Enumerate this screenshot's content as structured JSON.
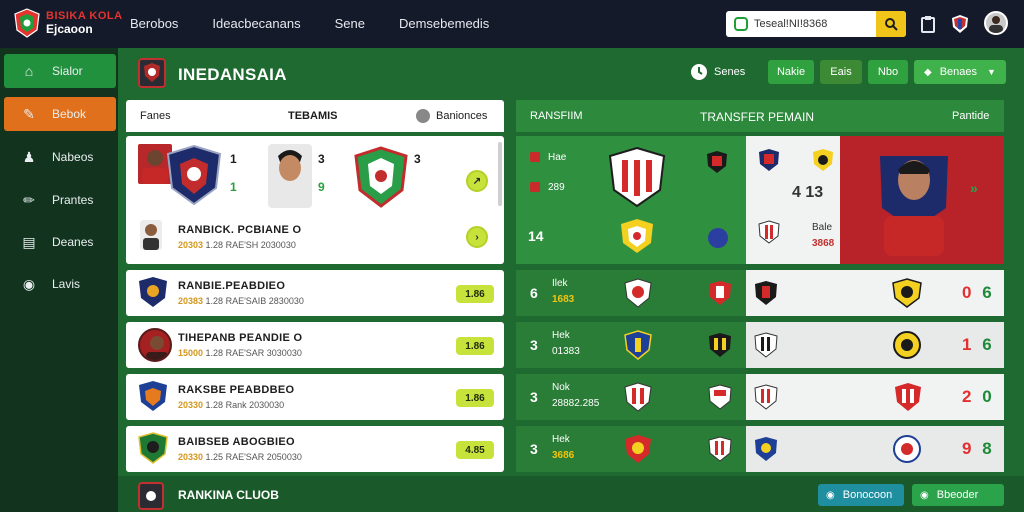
{
  "app": {
    "logo_line1": "BISIKA KOLA",
    "logo_line2": "Ejcaoon"
  },
  "topnav": [
    "Berobos",
    "Ideacbecanans",
    "Sene",
    "Demsebemedis"
  ],
  "search": {
    "value": "Teseal!NI!8368"
  },
  "sidebar": {
    "items": [
      {
        "label": "Sialor",
        "icon": "home-icon"
      },
      {
        "label": "Bebok",
        "icon": "boot-icon"
      },
      {
        "label": "Nabeos",
        "icon": "person-icon"
      },
      {
        "label": "Prantes",
        "icon": "pen-icon"
      },
      {
        "label": "Deanes",
        "icon": "calendar-icon"
      },
      {
        "label": "Lavis",
        "icon": "ball-icon"
      }
    ]
  },
  "header": {
    "club_name": "INEDANSAIA",
    "senes_label": "Senes",
    "btn1": "Nakie",
    "btn2": "Eais",
    "btn3": "Nbo",
    "btn4": "Benaes"
  },
  "left_panel": {
    "head_col1": "Fanes",
    "head_col2": "TEBAMIS",
    "head_col3": "Banionces",
    "top_card": {
      "numbers": [
        "1",
        "3",
        "3"
      ],
      "sub_numbers": [
        "1",
        "9"
      ],
      "player_name": "RANBICK. PCBIANE O",
      "player_code": "20303",
      "player_sub": "1.28 RAE'SH 2030030"
    },
    "players": [
      {
        "name": "RANBIE.PEABDIEO",
        "code": "20383",
        "sub": "1.28 RAE'SAIB 2830030",
        "value": "1.86"
      },
      {
        "name": "TIHEPANB PEANDIE O",
        "code": "15000",
        "sub": "1.28 RAE'SAR 3030030",
        "value": "1.86"
      },
      {
        "name": "RAKSBE PEABDBEO",
        "code": "20330",
        "sub": "1.28 Rank 2030030",
        "value": "1.86"
      },
      {
        "name": "BAIBSEB ABOGBIEO",
        "code": "20330",
        "sub": "1.25 RAE'SAR 2050030",
        "value": "4.85"
      }
    ],
    "footer_label": "RANKINA CLUOB"
  },
  "right_panel": {
    "head_col1": "RANSFIIM",
    "head_col2": "TRANSFER PEMAIN",
    "head_col3": "Pantide",
    "top_row": {
      "label1": "Hae",
      "label2": "289",
      "num": "14",
      "side_mid": "4 13",
      "side_label": "Bale",
      "side_code": "3868"
    },
    "rows": [
      {
        "num": "6",
        "label": "Ilek",
        "code": "1683",
        "score_a": "0",
        "score_b": "6"
      },
      {
        "num": "3",
        "label": "Hek",
        "code": "01383",
        "score_a": "1",
        "score_b": "6"
      },
      {
        "num": "3",
        "label": "Nok",
        "code": "28882.285",
        "score_a": "2",
        "score_b": "0"
      },
      {
        "num": "3",
        "label": "Hek",
        "code": "3686",
        "score_a": "9",
        "score_b": "8"
      }
    ]
  },
  "footer": {
    "btn1": "Bonocoon",
    "btn2": "Bbeoder"
  },
  "colors": {
    "accent_green": "#22913d",
    "accent_orange": "#e0701c",
    "value_pill": "#c8e23c",
    "score_red": "#e23030"
  }
}
